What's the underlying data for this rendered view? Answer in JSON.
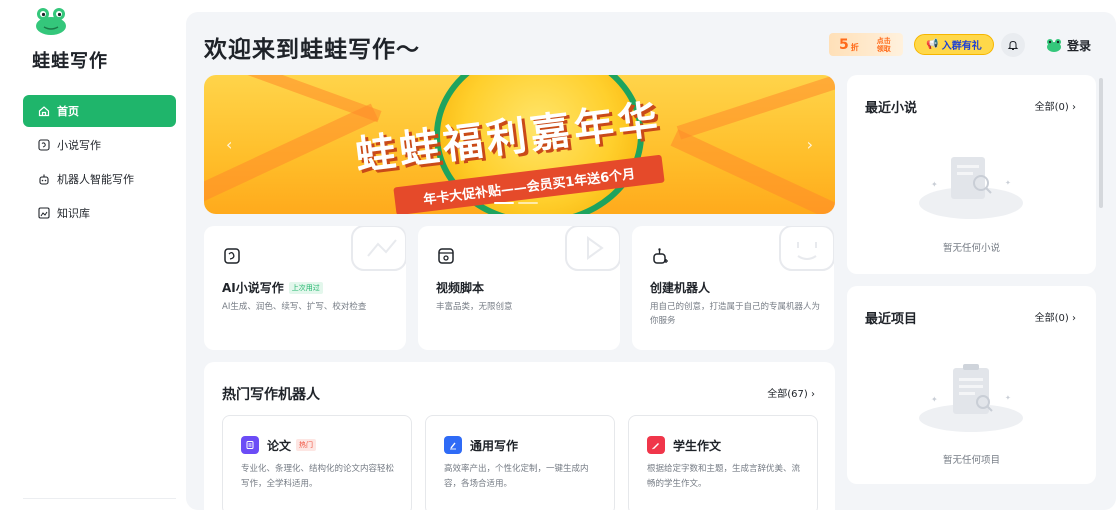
{
  "app": {
    "name": "蛙蛙写作"
  },
  "sidebar": {
    "items": [
      {
        "label": "首页",
        "icon": "home-icon",
        "active": true
      },
      {
        "label": "小说写作",
        "icon": "novel-icon",
        "active": false
      },
      {
        "label": "机器人智能写作",
        "icon": "robot-icon",
        "active": false
      },
      {
        "label": "知识库",
        "icon": "knowledge-base-icon",
        "active": false
      }
    ]
  },
  "header": {
    "title": "欢迎来到蛙蛙写作～",
    "promo": {
      "number": "5",
      "unit": "折",
      "claim": "点击领取"
    },
    "group_label": "入群有礼",
    "login_label": "登录"
  },
  "banner": {
    "headline": "蛙蛙福利嘉年华",
    "subline": "年卡大促补贴——会员买1年送6个月"
  },
  "features": [
    {
      "title": "AI小说写作",
      "tag": "上次用过",
      "desc": "AI生成、润色、续写、扩写、校对检查",
      "icon": "novel-icon"
    },
    {
      "title": "视频脚本",
      "tag": "",
      "desc": "丰富品类，无限创意",
      "icon": "video-icon"
    },
    {
      "title": "创建机器人",
      "tag": "",
      "desc": "用自己的创意，打造属于自己的专属机器人为你服务",
      "icon": "robot-icon"
    }
  ],
  "hot_robots": {
    "title": "热门写作机器人",
    "all_label": "全部(67) ›",
    "items": [
      {
        "title": "论文",
        "tag": "热门",
        "desc": "专业化、条理化、结构化的论文内容轻松写作，全学科适用。",
        "icon_color": "#6b4cf6"
      },
      {
        "title": "通用写作",
        "tag": "",
        "desc": "高效率产出，个性化定制，一键生成内容，各场合适用。",
        "icon_color": "#2f6bf6"
      },
      {
        "title": "学生作文",
        "tag": "",
        "desc": "根据给定字数和主题，生成言辞优美、流畅的学生作文。",
        "icon_color": "#f0364a"
      }
    ]
  },
  "recent_novels": {
    "title": "最近小说",
    "all_label": "全部(0) ›",
    "empty_text": "暂无任何小说"
  },
  "recent_projects": {
    "title": "最近项目",
    "all_label": "全部(0) ›",
    "empty_text": "暂无任何项目"
  },
  "colors": {
    "accent": "#1fb56b",
    "background": "#f3f5f8"
  }
}
